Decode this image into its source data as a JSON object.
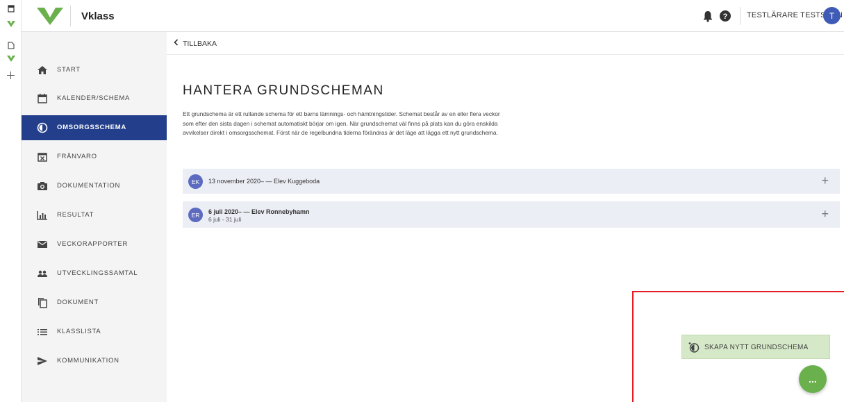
{
  "colors": {
    "primary": "#233f8c",
    "brand_green": "#6ab04c",
    "avatar_blue": "#3f5bb6",
    "highlight_red": "#e51c23",
    "create_bg": "#d5e8c7"
  },
  "browser_strip": {
    "icons": [
      "window-icon",
      "vklass-favicon",
      "page-icon",
      "vklass-favicon",
      "add-tab-icon"
    ]
  },
  "header": {
    "brand": "Vklass",
    "user_name": "TESTLÄRARE TESTSSON",
    "avatar_initial": "T",
    "icons": [
      "bell-icon",
      "help-icon"
    ]
  },
  "sidebar": {
    "items": [
      {
        "label": "START",
        "icon": "home-icon",
        "active": false
      },
      {
        "label": "KALENDER/SCHEMA",
        "icon": "calendar-icon",
        "active": false
      },
      {
        "label": "OMSORGSSCHEMA",
        "icon": "care-schedule-icon",
        "active": true
      },
      {
        "label": "FRÅNVARO",
        "icon": "absence-icon",
        "active": false
      },
      {
        "label": "DOKUMENTATION",
        "icon": "camera-icon",
        "active": false
      },
      {
        "label": "RESULTAT",
        "icon": "bar-chart-icon",
        "active": false
      },
      {
        "label": "VECKORAPPORTER",
        "icon": "mail-icon",
        "active": false
      },
      {
        "label": "UTVECKLINGSSAMTAL",
        "icon": "people-icon",
        "active": false
      },
      {
        "label": "DOKUMENT",
        "icon": "copy-icon",
        "active": false
      },
      {
        "label": "KLASSLISTA",
        "icon": "list-icon",
        "active": false
      },
      {
        "label": "KOMMUNIKATION",
        "icon": "send-icon",
        "active": false
      }
    ]
  },
  "main": {
    "back_label": "TILLBAKA",
    "title": "HANTERA GRUNDSCHEMAN",
    "description_lines": [
      "Ett grundschema är ett rullande schema för ett barns lämnings- och hämtningstider. Schemat består av en eller flera veckor",
      "som efter den sista dagen i schemat automatiskt börjar om igen. När grundschemat väl finns på plats kan du göra enskilda",
      "avvikelser direkt i omsorgsschemat. Först när de regelbundna tiderna förändras är det läge att lägga ett nytt grundschema."
    ],
    "schedules": [
      {
        "initials": "EK",
        "title": "13 november 2020– — Elev Kuggeboda",
        "subtitle": "",
        "plus": "+"
      },
      {
        "initials": "ER",
        "title": "6 juli 2020– — Elev Ronnebyhamn",
        "subtitle": "6 juli - 31 juli",
        "plus": "+"
      }
    ],
    "create_button_label": "SKAPA NYTT GRUNDSCHEMA",
    "fab_label": "..."
  }
}
